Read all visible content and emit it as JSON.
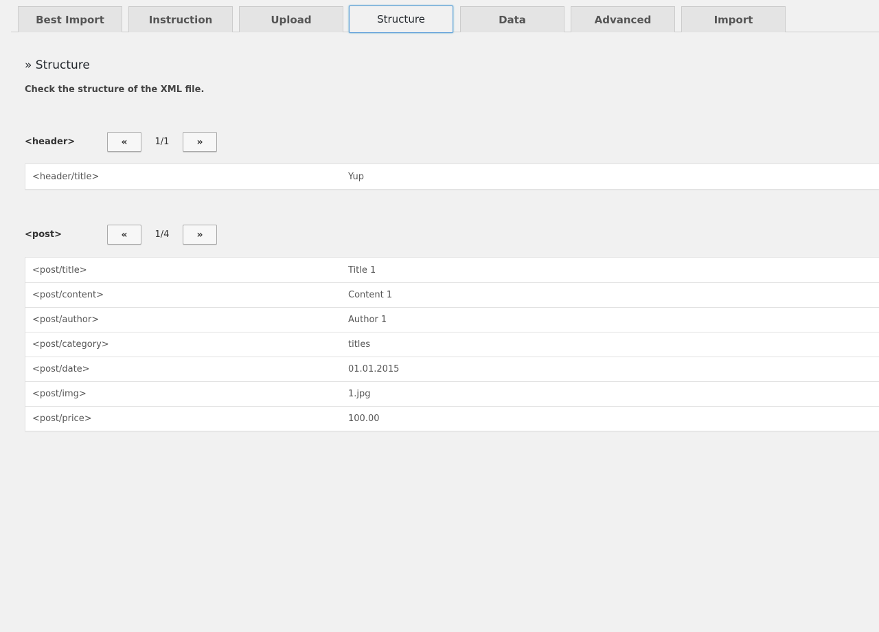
{
  "tabs": [
    {
      "label": "Best Import",
      "active": false
    },
    {
      "label": "Instruction",
      "active": false
    },
    {
      "label": "Upload",
      "active": false
    },
    {
      "label": "Structure",
      "active": true
    },
    {
      "label": "Data",
      "active": false
    },
    {
      "label": "Advanced",
      "active": false
    },
    {
      "label": "Import",
      "active": false
    }
  ],
  "section": {
    "title": "» Structure",
    "description": "Check the structure of the XML file."
  },
  "groups": [
    {
      "label": "<header>",
      "prev_label": "«",
      "next_label": "»",
      "page": "1/1",
      "rows": [
        {
          "key": "<header/title>",
          "value": "Yup"
        }
      ]
    },
    {
      "label": "<post>",
      "prev_label": "«",
      "next_label": "»",
      "page": "1/4",
      "rows": [
        {
          "key": "<post/title>",
          "value": "Title 1"
        },
        {
          "key": "<post/content>",
          "value": "Content 1"
        },
        {
          "key": "<post/author>",
          "value": "Author 1"
        },
        {
          "key": "<post/category>",
          "value": "titles"
        },
        {
          "key": "<post/date>",
          "value": "01.01.2015"
        },
        {
          "key": "<post/img>",
          "value": "1.jpg"
        },
        {
          "key": "<post/price>",
          "value": "100.00"
        }
      ]
    }
  ]
}
